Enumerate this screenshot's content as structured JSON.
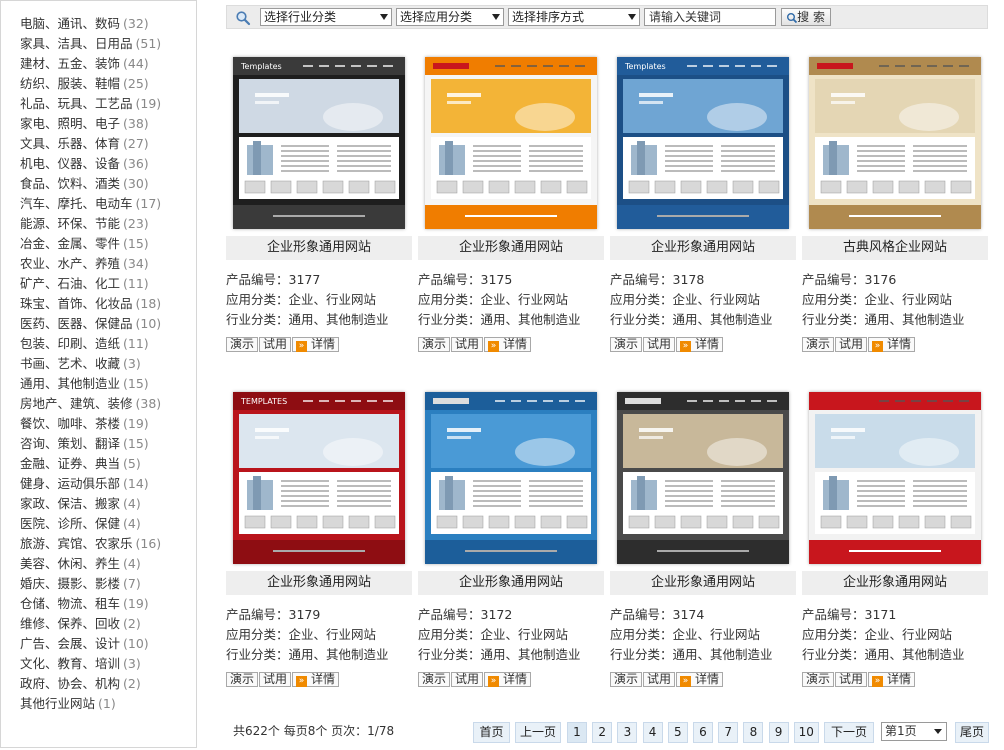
{
  "sidebar": {
    "items": [
      {
        "label": "电脑、通讯、数码",
        "count": "(32)"
      },
      {
        "label": "家具、洁具、日用品",
        "count": "(51)"
      },
      {
        "label": "建材、五金、装饰",
        "count": "(44)"
      },
      {
        "label": "纺织、服装、鞋帽",
        "count": "(25)"
      },
      {
        "label": "礼品、玩具、工艺品",
        "count": "(19)"
      },
      {
        "label": "家电、照明、电子",
        "count": "(38)"
      },
      {
        "label": "文具、乐器、体育",
        "count": "(27)"
      },
      {
        "label": "机电、仪器、设备",
        "count": "(36)"
      },
      {
        "label": "食品、饮料、酒类",
        "count": "(30)"
      },
      {
        "label": "汽车、摩托、电动车",
        "count": "(17)"
      },
      {
        "label": "能源、环保、节能",
        "count": "(23)"
      },
      {
        "label": "冶金、金属、零件",
        "count": "(15)"
      },
      {
        "label": "农业、水产、养殖",
        "count": "(34)"
      },
      {
        "label": "矿产、石油、化工",
        "count": "(11)"
      },
      {
        "label": "珠宝、首饰、化妆品",
        "count": "(18)"
      },
      {
        "label": "医药、医器、保健品",
        "count": "(10)"
      },
      {
        "label": "包装、印刷、造纸",
        "count": "(11)"
      },
      {
        "label": "书画、艺术、收藏",
        "count": "(3)"
      },
      {
        "label": "通用、其他制造业",
        "count": "(15)"
      },
      {
        "label": "房地产、建筑、装修",
        "count": "(38)"
      },
      {
        "label": "餐饮、咖啡、茶楼",
        "count": "(19)"
      },
      {
        "label": "咨询、策划、翻译",
        "count": "(15)"
      },
      {
        "label": "金融、证券、典当",
        "count": "(5)"
      },
      {
        "label": "健身、运动俱乐部",
        "count": "(14)"
      },
      {
        "label": "家政、保洁、搬家",
        "count": "(4)"
      },
      {
        "label": "医院、诊所、保健",
        "count": "(4)"
      },
      {
        "label": "旅游、宾馆、农家乐",
        "count": "(16)"
      },
      {
        "label": "美容、休闲、养生",
        "count": "(4)"
      },
      {
        "label": "婚庆、摄影、影楼",
        "count": "(7)"
      },
      {
        "label": "仓储、物流、租车",
        "count": "(19)"
      },
      {
        "label": "维修、保养、回收",
        "count": "(2)"
      },
      {
        "label": "广告、会展、设计",
        "count": "(10)"
      },
      {
        "label": "文化、教育、培训",
        "count": "(3)"
      },
      {
        "label": "政府、协会、机构",
        "count": "(2)"
      },
      {
        "label": "其他行业网站",
        "count": "(1)"
      }
    ]
  },
  "search": {
    "industry_select": "选择行业分类",
    "app_select": "选择应用分类",
    "sort_select": "选择排序方式",
    "keyword_placeholder": "请输入关键词",
    "button": "搜 索"
  },
  "labels": {
    "code": "产品编号：",
    "app": "应用分类：",
    "industry": "行业分类：",
    "demo": "演示",
    "trial": "试用",
    "detail": "详情"
  },
  "products": [
    {
      "name": "企业形象通用网站",
      "code": "3177",
      "app": "企业、行业网站",
      "industry": "通用、其他制造业",
      "theme": "#1e1e1e",
      "accent": "#3a3a3a",
      "banner": "#cfd9e4",
      "logo": "Templates"
    },
    {
      "name": "企业形象通用网站",
      "code": "3175",
      "app": "企业、行业网站",
      "industry": "通用、其他制造业",
      "theme": "#f5f5f5",
      "accent": "#f07d00",
      "banner": "#f3b437",
      "logo": ""
    },
    {
      "name": "企业形象通用网站",
      "code": "3178",
      "app": "企业、行业网站",
      "industry": "通用、其他制造业",
      "theme": "#1c4f86",
      "accent": "#215c9a",
      "banner": "#6fa5d3",
      "logo": "Templates"
    },
    {
      "name": "古典风格企业网站",
      "code": "3176",
      "app": "企业、行业网站",
      "industry": "通用、其他制造业",
      "theme": "#efe3c6",
      "accent": "#b08a4f",
      "banner": "#e4d6b4",
      "logo": ""
    },
    {
      "name": "企业形象通用网站",
      "code": "3179",
      "app": "企业、行业网站",
      "industry": "通用、其他制造业",
      "theme": "#b9141b",
      "accent": "#8e0d12",
      "banner": "#dce6ef",
      "logo": "TEMPLATES"
    },
    {
      "name": "企业形象通用网站",
      "code": "3172",
      "app": "企业、行业网站",
      "industry": "通用、其他制造业",
      "theme": "#2b7fc0",
      "accent": "#1c5e9a",
      "banner": "#4a9ad6",
      "logo": ""
    },
    {
      "name": "企业形象通用网站",
      "code": "3174",
      "app": "企业、行业网站",
      "industry": "通用、其他制造业",
      "theme": "#4a4a4a",
      "accent": "#2d2d2d",
      "banner": "#c8b89a",
      "logo": ""
    },
    {
      "name": "企业形象通用网站",
      "code": "3171",
      "app": "企业、行业网站",
      "industry": "通用、其他制造业",
      "theme": "#f2f2f2",
      "accent": "#c8161d",
      "banner": "#c9dcea",
      "logo": ""
    }
  ],
  "pager": {
    "summary": "共622个 每页8个 页次：1/78",
    "first": "首页",
    "prev": "上一页",
    "pages": [
      "1",
      "2",
      "3",
      "4",
      "5",
      "6",
      "7",
      "8",
      "9",
      "10"
    ],
    "next": "下一页",
    "select": "第1页",
    "last": "尾页"
  }
}
